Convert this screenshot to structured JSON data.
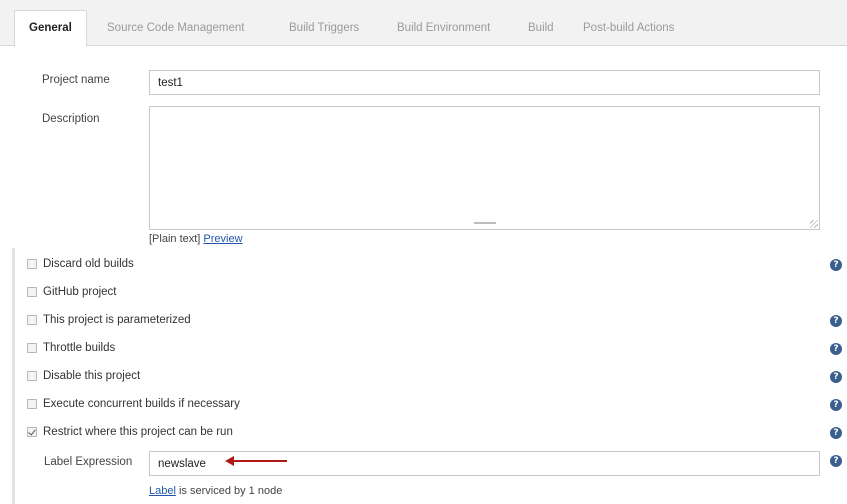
{
  "tabs": [
    {
      "label": "General",
      "active": true
    },
    {
      "label": "Source Code Management",
      "active": false
    },
    {
      "label": "Build Triggers",
      "active": false
    },
    {
      "label": "Build Environment",
      "active": false
    },
    {
      "label": "Build",
      "active": false
    },
    {
      "label": "Post-build Actions",
      "active": false
    }
  ],
  "project_name": {
    "label": "Project name",
    "value": "test1"
  },
  "description": {
    "label": "Description",
    "value": ""
  },
  "format": {
    "prefix": "[Plain text]",
    "preview_link": "Preview"
  },
  "options": [
    {
      "label": "Discard old builds",
      "checked": false,
      "help": true
    },
    {
      "label": "GitHub project",
      "checked": false,
      "help": false
    },
    {
      "label": "This project is parameterized",
      "checked": false,
      "help": true
    },
    {
      "label": "Throttle builds",
      "checked": false,
      "help": true
    },
    {
      "label": "Disable this project",
      "checked": false,
      "help": true
    },
    {
      "label": "Execute concurrent builds if necessary",
      "checked": false,
      "help": true
    },
    {
      "label": "Restrict where this project can be run",
      "checked": true,
      "help": true
    }
  ],
  "label_expression": {
    "label": "Label Expression",
    "value": "newslave"
  },
  "serviced": {
    "link": "Label",
    "text": " is serviced by 1 node"
  },
  "help_glyph": "?",
  "icons": {
    "help": "help-icon",
    "arrow": "red-arrow-annotation"
  },
  "colors": {
    "help_icon": "#3a5f8f",
    "link": "#2255aa",
    "annotation_arrow": "#b01818"
  }
}
